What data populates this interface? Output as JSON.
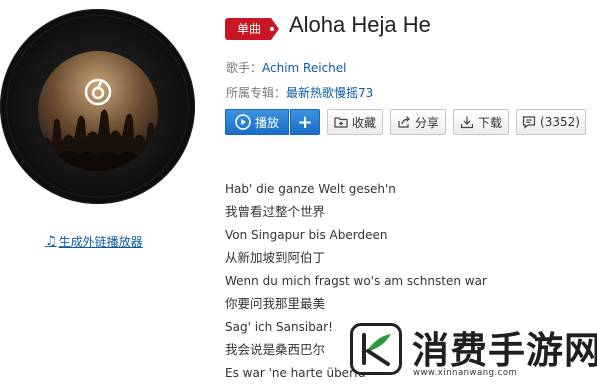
{
  "tag": {
    "label": "单曲"
  },
  "song": {
    "title": "Aloha Heja He",
    "artist_label": "歌手：",
    "artist": "Achim Reichel",
    "album_label": "所属专辑：",
    "album": "最新热歌慢摇73"
  },
  "actions": {
    "play": "播放",
    "add": "+",
    "favorite": "收藏",
    "share": "分享",
    "download": "下载",
    "comments": "(3352)"
  },
  "sidebar": {
    "generate_player_link": "生成外链播放器"
  },
  "lyrics": [
    "Hab' die ganze Welt geseh'n",
    "我曾看过整个世界",
    "Von Singapur bis Aberdeen",
    "从新加坡到阿伯丁",
    "Wenn du mich fragst wo's am schnsten war",
    "你要问我那里最美",
    "Sag' ich Sansibar!",
    "我会说是桑西巴尔",
    "Es war 'ne harte überfa"
  ],
  "watermark": {
    "brand": "消费手游网",
    "url": "www.xinnanwang.com"
  },
  "colors": {
    "accent_blue": "#1a6ec4",
    "tag_red": "#c81623",
    "link_blue": "#0c5aa6"
  }
}
